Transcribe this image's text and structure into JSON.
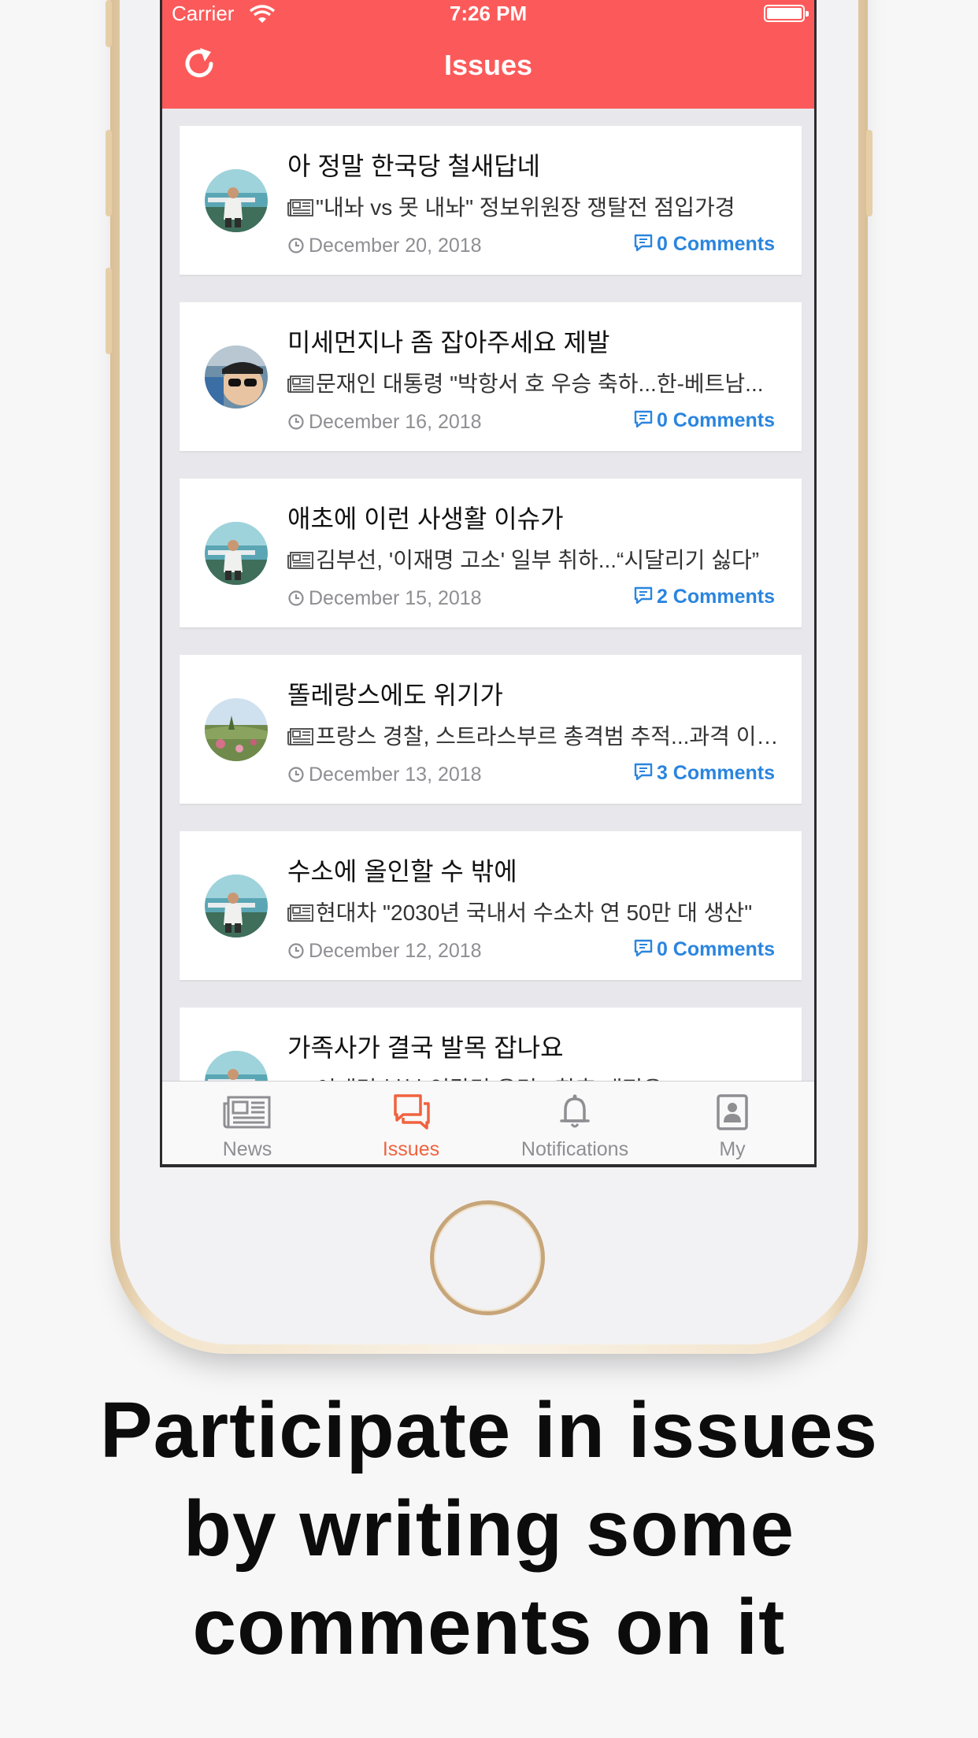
{
  "status_bar": {
    "carrier": "Carrier",
    "time": "7:26 PM"
  },
  "navbar": {
    "title": "Issues",
    "refresh_icon": "refresh-icon"
  },
  "issues": [
    {
      "title": "아 정말 한국당 철새답네",
      "news": "\"내놔 vs 못 내놔\" 정보위원장 쟁탈전 점입가경",
      "date": "December 20, 2018",
      "comments": "0 Comments",
      "avatar": "person-at-beach"
    },
    {
      "title": "미세먼지나 좀 잡아주세요 제발",
      "news": "문재인 대통령 \"박항서 호 우승 축하...한-베트남...",
      "date": "December 16, 2018",
      "comments": "0 Comments",
      "avatar": "person-with-sunglasses"
    },
    {
      "title": "애초에 이런 사생활 이슈가",
      "news": "김부선, '이재명 고소' 일부 취하...“시달리기 싫다”",
      "date": "December 15, 2018",
      "comments": "2 Comments",
      "avatar": "person-at-beach"
    },
    {
      "title": "똘레랑스에도 위기가",
      "news": "프랑스 경찰, 스트라스부르 총격범 추적...과격 이…",
      "date": "December 13, 2018",
      "comments": "3 Comments",
      "avatar": "field-landscape"
    },
    {
      "title": "수소에 올인할 수 밖에",
      "news": "현대차 \"2030년 국내서 수소차 연 50만 대 생산\"",
      "date": "December 12, 2018",
      "comments": "0 Comments",
      "avatar": "person-at-beach"
    },
    {
      "title": "가족사가 결국 발목 잡나요",
      "news": "이재명 부부 엇갈린 운명...향후 재정은?",
      "date": "",
      "comments": "",
      "avatar": "person-at-beach"
    }
  ],
  "tabs": [
    {
      "label": "News",
      "icon": "newspaper-icon",
      "active": false
    },
    {
      "label": "Issues",
      "icon": "chat-bubbles-icon",
      "active": true
    },
    {
      "label": "Notifications",
      "icon": "bell-icon",
      "active": false
    },
    {
      "label": "My",
      "icon": "profile-icon",
      "active": false
    }
  ],
  "caption": {
    "line1": "Participate in issues",
    "line2": "by writing some",
    "line3": "comments on it"
  },
  "colors": {
    "nav_red": "#fc5a5a",
    "link_blue": "#2a85de",
    "tab_active": "#f0623f",
    "tab_inactive": "#8e8e93"
  }
}
